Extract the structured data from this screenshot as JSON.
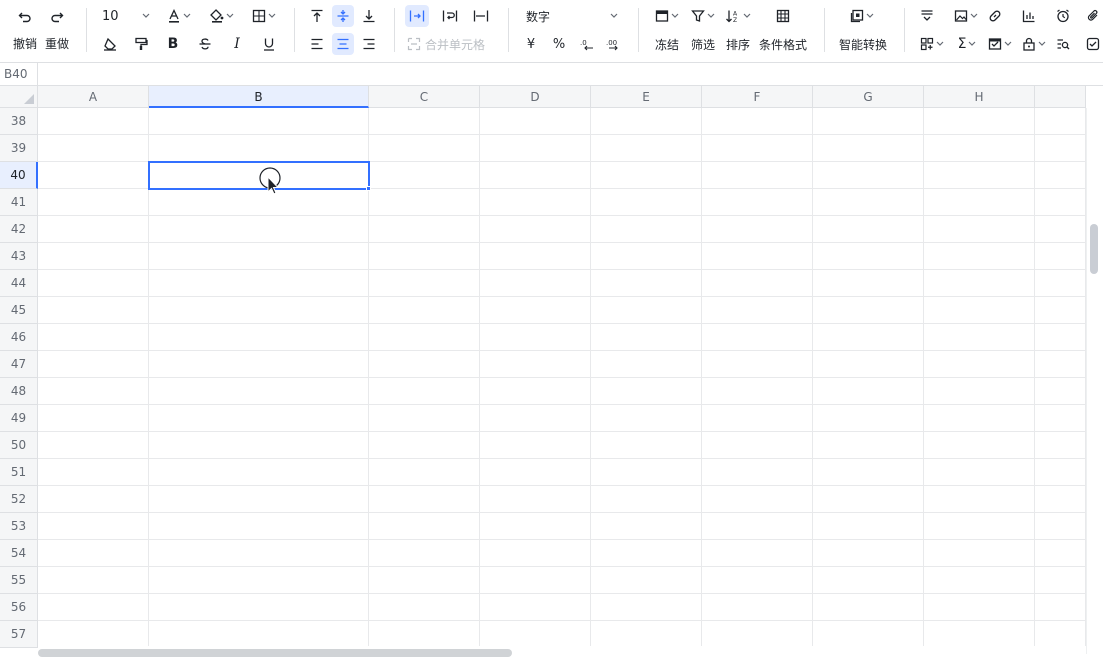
{
  "toolbar": {
    "undo_label": "撤销",
    "redo_label": "重做",
    "font_size": "10",
    "merge_label": "合并单元格",
    "number_format": "数字",
    "currency_symbol": "¥",
    "percent_symbol": "%",
    "freeze_label": "冻结",
    "filter_label": "筛选",
    "sort_label": "排序",
    "conditional_format_label": "条件格式",
    "smart_convert_label": "智能转换",
    "sum_symbol": "Σ"
  },
  "formula_bar": {
    "cell_ref": "B40"
  },
  "grid": {
    "columns": [
      "A",
      "B",
      "C",
      "D",
      "E",
      "F",
      "G",
      "H"
    ],
    "rows": [
      "38",
      "39",
      "40",
      "41",
      "42",
      "43",
      "44",
      "45",
      "46",
      "47",
      "48",
      "49",
      "50",
      "51",
      "52",
      "53",
      "54",
      "55",
      "56",
      "57"
    ],
    "selected_column": "B",
    "selected_row": "40"
  },
  "colors": {
    "accent": "#3370ff",
    "header_bg": "#f5f6f7",
    "grid_line": "#e8e9eb"
  }
}
